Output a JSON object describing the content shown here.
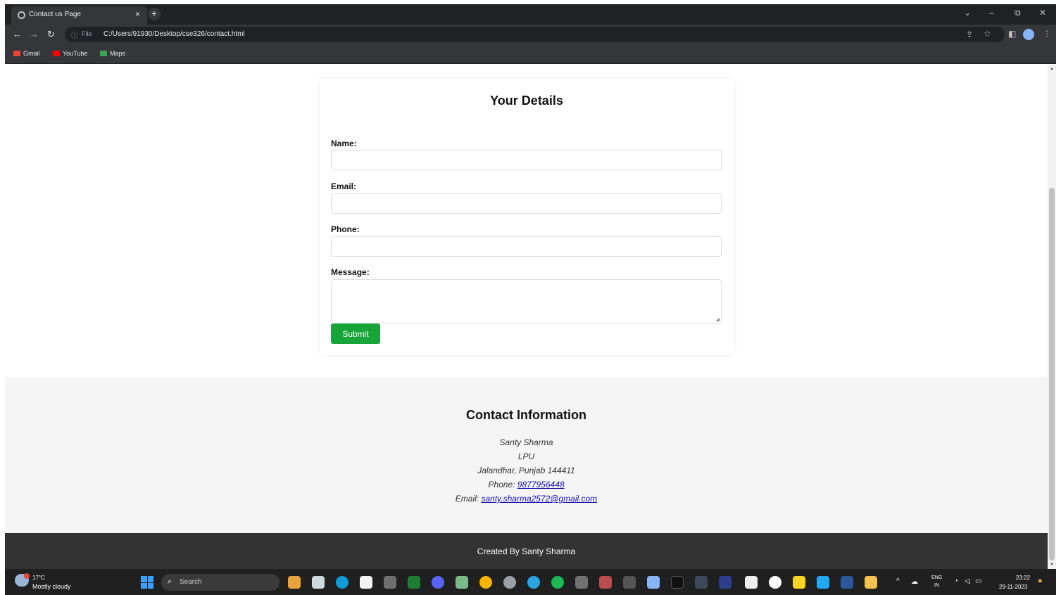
{
  "browser": {
    "tab_title": "Contact us Page",
    "tab_close": "×",
    "new_tab": "+",
    "window_controls": [
      "⌄",
      "–",
      "⧉",
      "✕"
    ],
    "info_icon": "ⓘ",
    "file_label": "File",
    "url": "C:/Users/91930/Desktop/cse326/contact.html",
    "bookmarks": [
      {
        "label": "Gmail",
        "color": "#ea4335"
      },
      {
        "label": "YouTube",
        "color": "#ff0000"
      },
      {
        "label": "Maps",
        "color": "#34a853"
      }
    ]
  },
  "form": {
    "title": "Your Details",
    "name_label": "Name:",
    "email_label": "Email:",
    "phone_label": "Phone:",
    "message_label": "Message:",
    "submit_label": "Submit",
    "name_value": "",
    "email_value": "",
    "phone_value": ""
  },
  "contact": {
    "title": "Contact Information",
    "name": "Santy Sharma",
    "org": "LPU",
    "address": "Jalandhar, Punjab 144411",
    "phone_prefix": "Phone: ",
    "phone": "9877956448",
    "email_prefix": "Email: ",
    "email": "santy.sharma2572@gmail.com"
  },
  "footer": {
    "text": "Created By Santy Sharma"
  },
  "taskbar": {
    "temperature": "17°C",
    "condition": "Mostly cloudy",
    "search_label": "Search",
    "language": "ENG",
    "region": "IN",
    "time": "23:22",
    "date": "29-11-2023"
  },
  "colors": {
    "submit": "#17a53a",
    "footer_bg": "#333333",
    "contact_bg": "#f5f5f5",
    "link": "#1a0dab"
  }
}
